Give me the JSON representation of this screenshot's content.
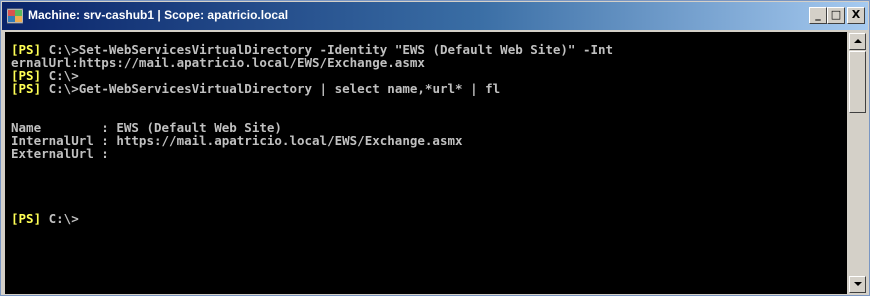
{
  "window": {
    "title": "Machine: srv-cashub1 | Scope: apatricio.local",
    "controls": {
      "minimize": "_",
      "maximize": "□",
      "close": "X"
    },
    "icon": "powershell-console-icon"
  },
  "console": {
    "lines": [
      {
        "prompt": "[PS]",
        "text": " C:\\>Set-WebServicesVirtualDirectory -Identity \"EWS (Default Web Site)\" -Int"
      },
      {
        "prompt": "",
        "text": "ernalUrl:https://mail.apatricio.local/EWS/Exchange.asmx"
      },
      {
        "prompt": "[PS]",
        "text": " C:\\>"
      },
      {
        "prompt": "[PS]",
        "text": " C:\\>Get-WebServicesVirtualDirectory | select name,*url* | fl"
      },
      {
        "prompt": "",
        "text": ""
      },
      {
        "prompt": "",
        "text": ""
      },
      {
        "prompt": "",
        "text": "Name        : EWS (Default Web Site)"
      },
      {
        "prompt": "",
        "text": "InternalUrl : https://mail.apatricio.local/EWS/Exchange.asmx"
      },
      {
        "prompt": "",
        "text": "ExternalUrl :"
      },
      {
        "prompt": "",
        "text": ""
      },
      {
        "prompt": "",
        "text": ""
      },
      {
        "prompt": "",
        "text": ""
      },
      {
        "prompt": "",
        "text": ""
      },
      {
        "prompt": "[PS]",
        "text": " C:\\>"
      }
    ]
  },
  "colors": {
    "prompt": "#ffff55",
    "output": "#c0c0c0",
    "background": "#000000"
  }
}
